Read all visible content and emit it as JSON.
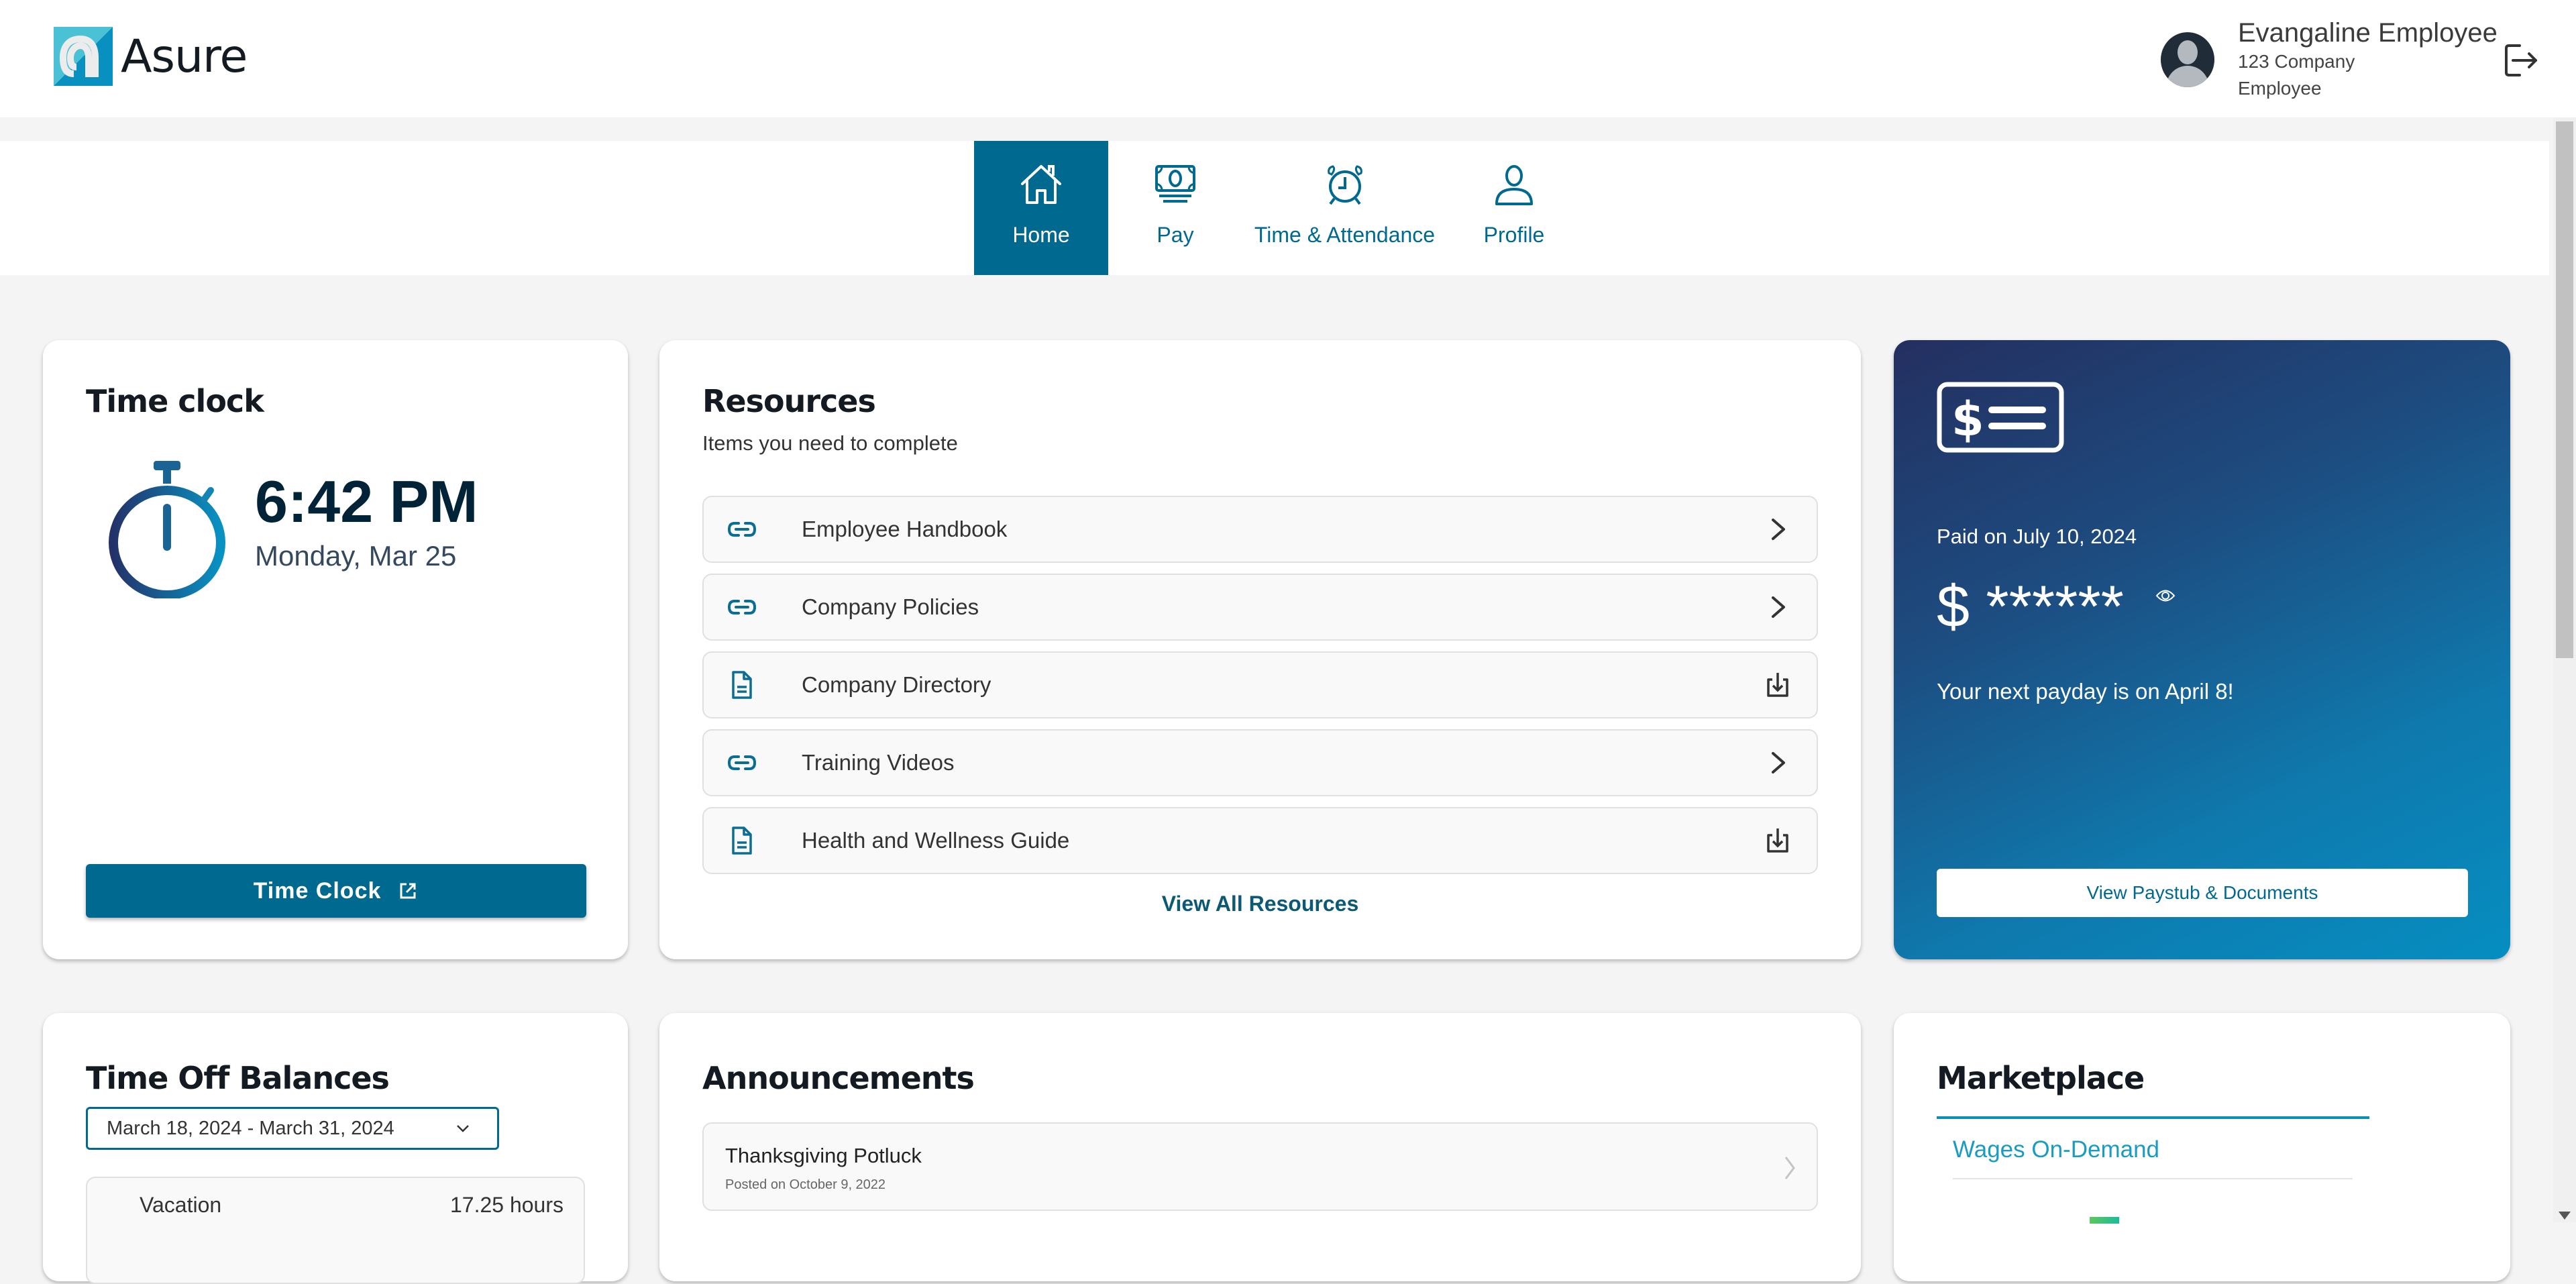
{
  "app": {
    "brand": "Asure",
    "brand_colors": {
      "primary": "#006990",
      "accent": "#0a8fb5",
      "logo_light": "#4ac1d4",
      "logo_dark": "#0891c0"
    }
  },
  "user": {
    "name": "Evangaline Employee",
    "company": "123 Company",
    "role": "Employee",
    "avatar_icon": "user-avatar-icon",
    "logout_icon": "logout-icon"
  },
  "nav": {
    "tabs": [
      {
        "label": "Home",
        "icon": "home-icon",
        "active": true
      },
      {
        "label": "Pay",
        "icon": "money-icon",
        "active": false
      },
      {
        "label": "Time & Attendance",
        "icon": "alarm-clock-icon",
        "active": false
      },
      {
        "label": "Profile",
        "icon": "person-icon",
        "active": false
      }
    ]
  },
  "time_clock": {
    "title": "Time clock",
    "time": "6:42 PM",
    "date": "Monday, Mar 25",
    "button_label": "Time Clock",
    "button_icon": "external-link-icon"
  },
  "resources": {
    "title": "Resources",
    "subtitle": "Items you need to complete",
    "items": [
      {
        "label": "Employee Handbook",
        "icon": "link-icon",
        "action": "chevron-right-icon"
      },
      {
        "label": "Company Policies",
        "icon": "link-icon",
        "action": "chevron-right-icon"
      },
      {
        "label": "Company Directory",
        "icon": "document-icon",
        "action": "download-icon"
      },
      {
        "label": "Training Videos",
        "icon": "link-icon",
        "action": "chevron-right-icon"
      },
      {
        "label": "Health and Wellness Guide",
        "icon": "document-icon",
        "action": "download-icon"
      }
    ],
    "view_all_label": "View All Resources"
  },
  "pay": {
    "icon": "paycheck-icon",
    "paid_on": "Paid on July 10, 2024",
    "amount_masked": "$ ******",
    "reveal_icon": "eye-icon",
    "next_payday": "Your next payday is on April 8!",
    "button_label": "View Paystub & Documents"
  },
  "time_off": {
    "title": "Time Off Balances",
    "selected_range": "March 18, 2024 - March 31, 2024",
    "balances": [
      {
        "type": "Vacation",
        "amount": "17.25 hours"
      }
    ]
  },
  "announcements": {
    "title": "Announcements",
    "items": [
      {
        "title": "Thanksgiving Potluck",
        "posted": "Posted on October 9, 2022"
      }
    ]
  },
  "marketplace": {
    "title": "Marketplace",
    "items": [
      {
        "label": "Wages On-Demand"
      }
    ]
  }
}
